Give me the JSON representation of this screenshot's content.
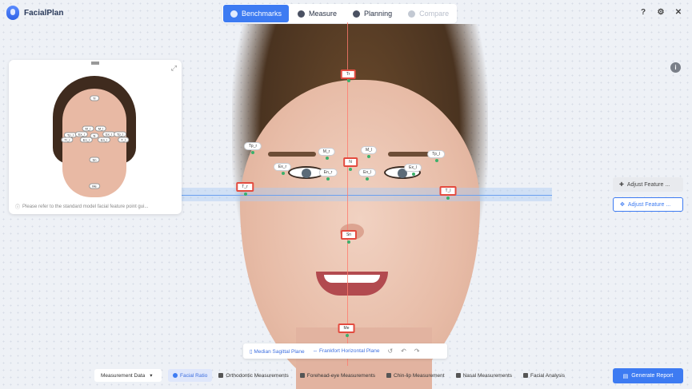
{
  "app": {
    "name": "FacialPlan"
  },
  "modes": [
    {
      "label": "Benchmarks",
      "icon": "landmark-icon",
      "active": true
    },
    {
      "label": "Measure",
      "icon": "measure-face-icon",
      "active": false
    },
    {
      "label": "Planning",
      "icon": "planning-face-icon",
      "active": false
    },
    {
      "label": "Compare",
      "icon": "compare-icon",
      "active": false,
      "disabled": true
    }
  ],
  "window_controls": {
    "help": "?",
    "settings": "⚙",
    "close": "✕"
  },
  "reference_panel": {
    "note": "Please refer to the standard model facial feature point gui...",
    "landmarks": [
      "Tr",
      "Tp_r",
      "Tr_r",
      "Ex_r",
      "En_r",
      "M_r",
      "N",
      "M_l",
      "En_l",
      "Ex_l",
      "Tp_l",
      "T_l",
      "Sn",
      "Me"
    ]
  },
  "landmarks": {
    "tr": "Tr",
    "tp_r": "Tp_r",
    "tp_l": "Tp_l",
    "m_r": "M_r",
    "m_l": "M_l",
    "ex_r": "Ex_r",
    "ex_l": "Ex_l",
    "en_r": "En_r",
    "en_l": "En_l",
    "n": "N",
    "t_r": "T_r",
    "t_l": "T_l",
    "sn": "Sn",
    "me": "Me"
  },
  "side_buttons": {
    "adjust1": "Adjust Feature ...",
    "adjust2": "Adjust Feature ..."
  },
  "plane_bar": {
    "median": "Median Sagittal Plane",
    "frankfort": "Frankfort Horizontal Plane"
  },
  "bottom": {
    "measurement_data": "Measurement Data",
    "tabs": [
      {
        "label": "Facial Ratio",
        "active": true
      },
      {
        "label": "Orthodontic Measurements",
        "active": false
      },
      {
        "label": "Forehead-eye Measurements",
        "active": false
      },
      {
        "label": "Chin-lip Measurement",
        "active": false
      },
      {
        "label": "Nasal Measurements",
        "active": false
      },
      {
        "label": "Facial Analysis",
        "active": false
      }
    ],
    "generate": "Generate Report"
  },
  "colors": {
    "accent": "#3d7bf2",
    "landmark_highlight": "#e34b3f",
    "landmark_dot": "#3bb06b",
    "median_line": "#ff7a6e"
  }
}
